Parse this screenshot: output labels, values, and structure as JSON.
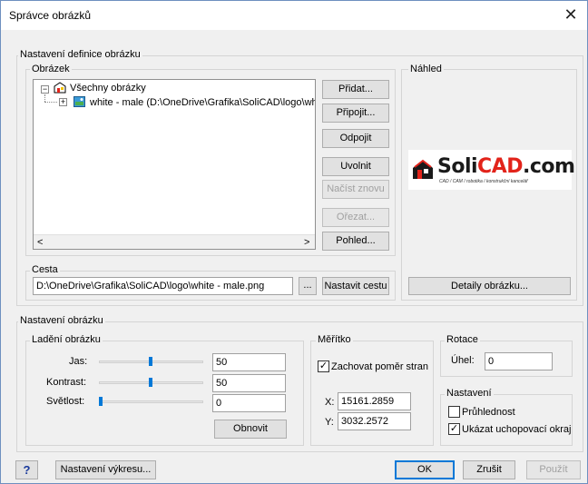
{
  "window": {
    "title": "Správce obrázků",
    "close_glyph": "✕"
  },
  "definition_group": {
    "label": "Nastavení definice obrázku"
  },
  "image_group": {
    "label": "Obrázek",
    "tree": {
      "root_label": "Všechny obrázky",
      "child_label": "white - male  (D:\\OneDrive\\Grafika\\SoliCAD\\logo\\wh"
    },
    "scroll_left": "<",
    "scroll_right": ">",
    "buttons": {
      "add": "Přidat...",
      "attach": "Připojit...",
      "detach": "Odpojit",
      "unload": "Uvolnit",
      "reload": "Načíst znovu",
      "clip": "Ořezat...",
      "view": "Pohled..."
    }
  },
  "path_group": {
    "label": "Cesta",
    "value": "D:\\OneDrive\\Grafika\\SoliCAD\\logo\\white - male.png",
    "browse_label": "...",
    "set_path_label": "Nastavit cestu"
  },
  "preview_group": {
    "label": "Náhled",
    "logo_text_soli": "Soli",
    "logo_text_cad": "CAD",
    "logo_text_com": ".com",
    "logo_tagline": "CAD / CAM / robotika / konstrukční kancelář",
    "details_button": "Detaily obrázku..."
  },
  "image_settings_group": {
    "label": "Nastavení obrázku"
  },
  "adjust_group": {
    "label": "Ladění obrázku",
    "brightness": {
      "label": "Jas:",
      "value": "50",
      "level_percent": 50
    },
    "contrast": {
      "label": "Kontrast:",
      "value": "50",
      "level_percent": 50
    },
    "fade": {
      "label": "Světlost:",
      "value": "0",
      "level_percent": 0
    },
    "reset_button": "Obnovit"
  },
  "scale_group": {
    "label": "Měřítko",
    "keep_ratio_label": "Zachovat poměr stran",
    "keep_ratio_checked": true,
    "x_label": "X:",
    "x_value": "15161.2859",
    "y_label": "Y:",
    "y_value": "3032.2572"
  },
  "rotation_group": {
    "label": "Rotace",
    "angle_label": "Úhel:",
    "angle_value": "0"
  },
  "settings_group": {
    "label": "Nastavení",
    "transparency_label": "Průhlednost",
    "transparency_checked": false,
    "show_frame_label": "Ukázat uchopovací okraj",
    "show_frame_checked": true
  },
  "footer": {
    "help_glyph": "?",
    "drawing_settings": "Nastavení výkresu...",
    "ok": "OK",
    "cancel": "Zrušit",
    "apply": "Použít"
  },
  "colors": {
    "accent": "#0078d7",
    "logo_red": "#e2231a",
    "logo_dark": "#1a1a1a"
  }
}
